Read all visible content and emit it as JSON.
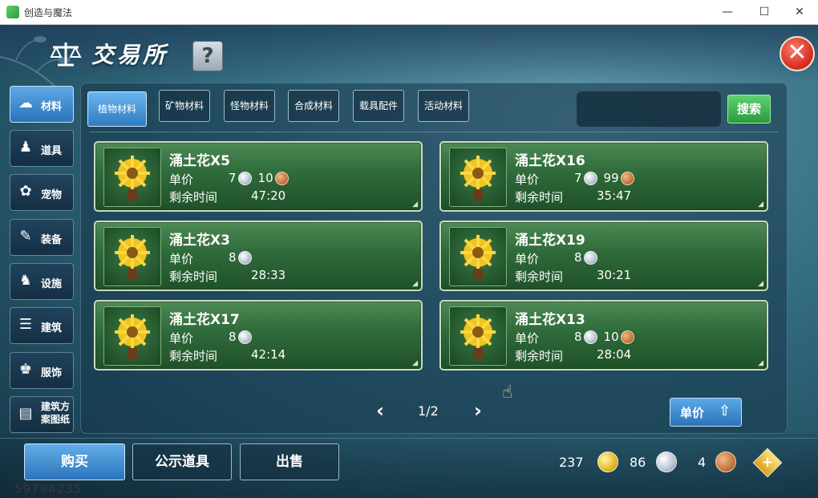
{
  "window": {
    "title": "创造与魔法",
    "controls": [
      "—",
      "☐",
      "✕"
    ]
  },
  "header": {
    "title": "交易所",
    "help_label": "?",
    "close_label": "✕"
  },
  "sidebar": {
    "items": [
      {
        "label": "材料",
        "icon": "cloud-icon",
        "glyph": "☁"
      },
      {
        "label": "道具",
        "icon": "flask-icon",
        "glyph": "♟"
      },
      {
        "label": "宠物",
        "icon": "paw-icon",
        "glyph": "✿"
      },
      {
        "label": "装备",
        "icon": "sword-icon",
        "glyph": "✎"
      },
      {
        "label": "设施",
        "icon": "horse-icon",
        "glyph": "♞"
      },
      {
        "label": "建筑",
        "icon": "wall-icon",
        "glyph": "☰"
      },
      {
        "label": "服饰",
        "icon": "shirt-icon",
        "glyph": "♚"
      },
      {
        "label": "建筑方案图纸",
        "icon": "blueprint-icon",
        "glyph": "▤"
      }
    ]
  },
  "tabs": [
    "植物材料",
    "矿物材料",
    "怪物材料",
    "合成材料",
    "载具配件",
    "活动材料"
  ],
  "search": {
    "placeholder": "",
    "button_label": "搜索"
  },
  "labels": {
    "price": "单价",
    "time_left": "剩余时间"
  },
  "listings": [
    {
      "name": "涌土花X5",
      "silver": "7",
      "copper": "10",
      "time": "47:20"
    },
    {
      "name": "涌土花X16",
      "silver": "7",
      "copper": "99",
      "time": "35:47"
    },
    {
      "name": "涌土花X3",
      "silver": "8",
      "copper": null,
      "time": "28:33"
    },
    {
      "name": "涌土花X19",
      "silver": "8",
      "copper": null,
      "time": "30:21"
    },
    {
      "name": "涌土花X17",
      "silver": "8",
      "copper": null,
      "time": "42:14"
    },
    {
      "name": "涌土花X13",
      "silver": "8",
      "copper": "10",
      "time": "28:04"
    }
  ],
  "pagination": {
    "text": "1/2",
    "prev": "‹",
    "next": "›"
  },
  "sort": {
    "label": "单价"
  },
  "actions": {
    "buy": "购买",
    "public": "公示道具",
    "sell": "出售"
  },
  "currency": {
    "gold": "237",
    "silver": "86",
    "copper": "4",
    "plus": "+"
  },
  "player_id": "59794235",
  "colors": {
    "accent": "#2f7bc1",
    "card": "#2f6a3a",
    "search": "#2c9a40",
    "close": "#d2291f"
  }
}
